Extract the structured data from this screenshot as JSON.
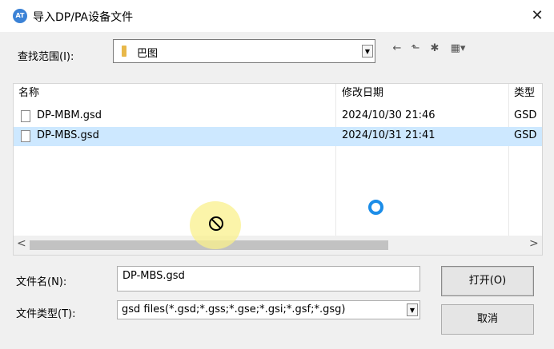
{
  "window": {
    "title": "导入DP/PA设备文件",
    "app_icon_text": "AT"
  },
  "look_in": {
    "label": "查找范围(I):",
    "value": "巴图"
  },
  "toolbar": {
    "back": "←",
    "up": "⬑",
    "new_folder": "✱",
    "view": "▦▾"
  },
  "columns": {
    "name": "名称",
    "modified": "修改日期",
    "type": "类型"
  },
  "files": [
    {
      "name": "DP-MBM.gsd",
      "modified": "2024/10/30 21:46",
      "type": "GSD",
      "selected": false
    },
    {
      "name": "DP-MBS.gsd",
      "modified": "2024/10/31 21:41",
      "type": "GSD",
      "selected": true
    }
  ],
  "filename": {
    "label": "文件名(N):",
    "value": "DP-MBS.gsd"
  },
  "filetype": {
    "label": "文件类型(T):",
    "value": "gsd files(*.gsd;*.gss;*.gse;*.gsi;*.gsf;*.gsg)"
  },
  "buttons": {
    "open": "打开(O)",
    "cancel": "取消"
  }
}
